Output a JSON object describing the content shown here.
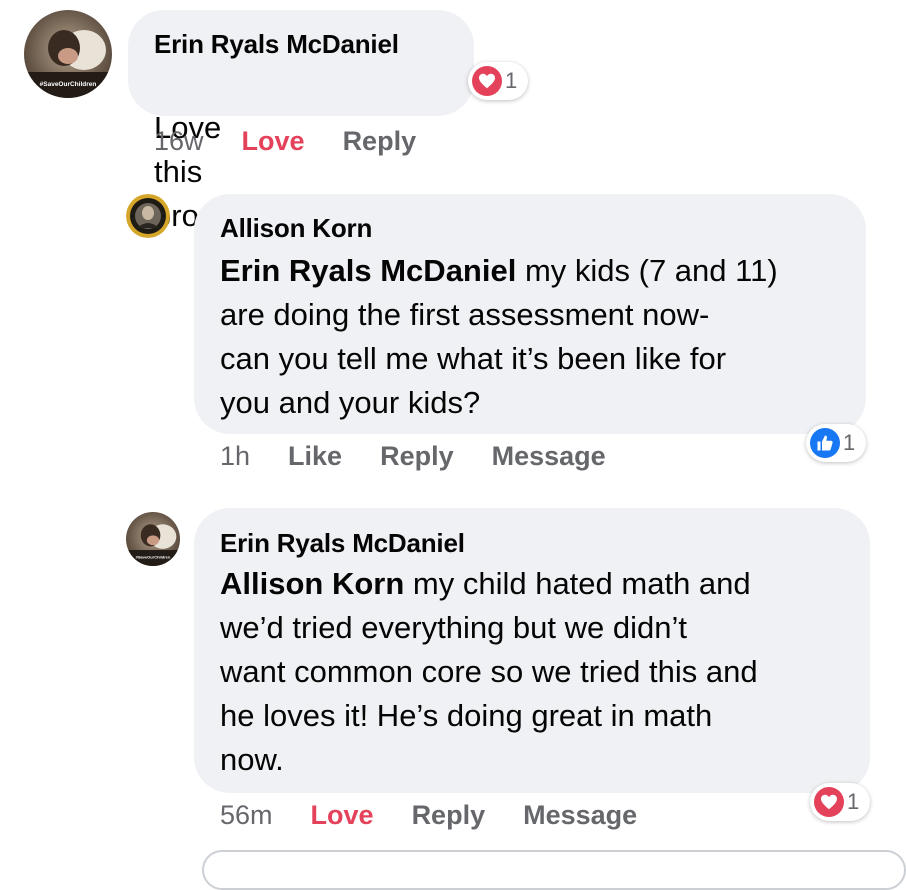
{
  "comments": [
    {
      "author": "Erin Ryals McDaniel",
      "text": "Love this program!",
      "actions": {
        "time": "16w",
        "love": "Love",
        "reply": "Reply"
      },
      "reaction": {
        "icon": "heart-icon",
        "count": "1",
        "color": "#e4425a"
      },
      "avatar": {
        "badge_text": "#SaveOurChildren"
      }
    },
    {
      "author": "Allison Korn",
      "mention": "Erin Ryals McDaniel",
      "text": " my kids (7 and 11)\nare doing the first assessment now-\ncan you tell me what it’s been like for\nyou and your kids?",
      "actions": {
        "time": "1h",
        "like": "Like",
        "reply": "Reply",
        "message": "Message"
      },
      "reaction": {
        "icon": "thumbs-up-icon",
        "count": "1",
        "color": "#1877f2"
      }
    },
    {
      "author": "Erin Ryals McDaniel",
      "mention": "Allison Korn",
      "text": " my child hated math and\nwe’d tried everything but we  didn’t\nwant common core so we tried this and\nhe loves it! He’s doing great in math\nnow.",
      "actions": {
        "time": "56m",
        "love": "Love",
        "reply": "Reply",
        "message": "Message"
      },
      "reaction": {
        "icon": "heart-icon",
        "count": "1",
        "color": "#e4425a"
      },
      "avatar": {
        "badge_text": "#SaveOurChildren"
      }
    }
  ],
  "colors": {
    "bubble": "#f0f1f4",
    "love": "#e4425a",
    "like": "#1877f2",
    "meta": "#65676b"
  }
}
